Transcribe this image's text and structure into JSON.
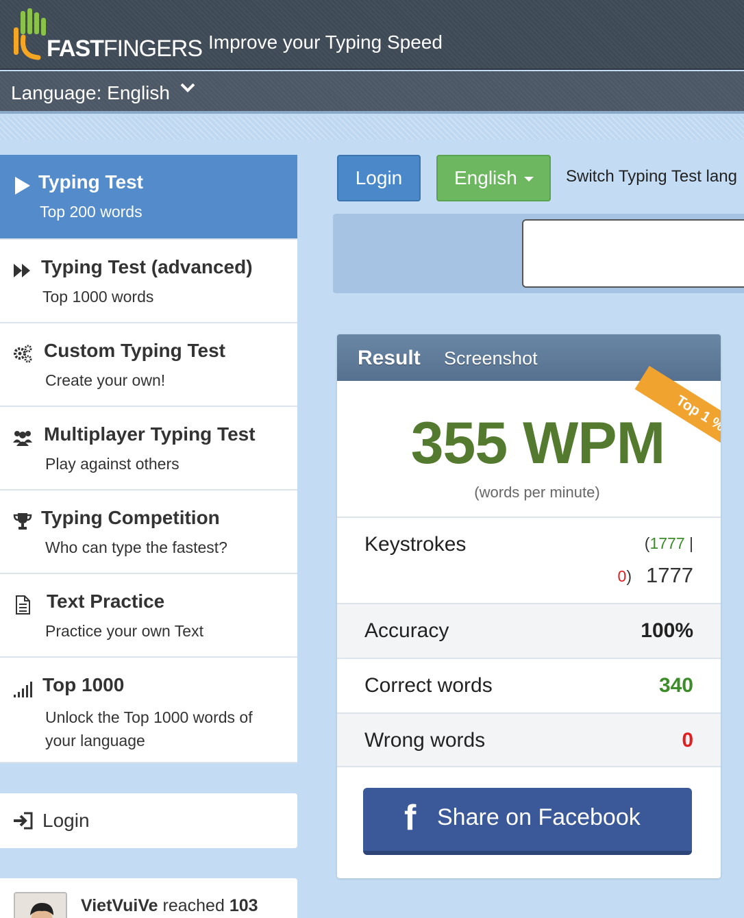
{
  "header": {
    "logo_prefix": "FAST",
    "logo_suffix": "FINGERS",
    "tagline": "Improve your Typing Speed",
    "language_label": "Language: English"
  },
  "sidebar": {
    "items": [
      {
        "title": "Typing Test",
        "subtitle": "Top 200 words",
        "icon": "play-icon",
        "active": true
      },
      {
        "title": "Typing Test (advanced)",
        "subtitle": "Top 1000 words",
        "icon": "fast-forward-icon"
      },
      {
        "title": "Custom Typing Test",
        "subtitle": "Create your own!",
        "icon": "gears-icon"
      },
      {
        "title": "Multiplayer Typing Test",
        "subtitle": "Play against others",
        "icon": "users-icon"
      },
      {
        "title": "Typing Competition",
        "subtitle": "Who can type the fastest?",
        "icon": "trophy-icon"
      },
      {
        "title": "Text Practice",
        "subtitle": "Practice your own Text",
        "icon": "document-icon"
      },
      {
        "title": "Top 1000",
        "subtitle": "Unlock the Top 1000 words of your language",
        "icon": "signal-bars-icon"
      }
    ],
    "login_label": "Login",
    "activity": {
      "user": "VietVuiVe",
      "text": " reached ",
      "value": "103"
    }
  },
  "toolbar": {
    "login_label": "Login",
    "language_button": "English",
    "switch_text": "Switch Typing Test lang"
  },
  "result": {
    "tab_result": "Result",
    "tab_screenshot": "Screenshot",
    "badge": "Top 1 %",
    "wpm": "355 WPM",
    "wpm_caption": "(words per minute)",
    "keystrokes_label": "Keystrokes",
    "keystrokes_correct": "1777",
    "keystrokes_wrong": "0",
    "keystrokes_total": "1777",
    "accuracy_label": "Accuracy",
    "accuracy_value": "100%",
    "correct_label": "Correct words",
    "correct_value": "340",
    "wrong_label": "Wrong words",
    "wrong_value": "0",
    "share_label": "Share on Facebook"
  },
  "colors": {
    "wpm_green": "#537a2e",
    "active_blue": "#538bcb",
    "facebook": "#3b5998",
    "ribbon": "#f0a32f"
  }
}
